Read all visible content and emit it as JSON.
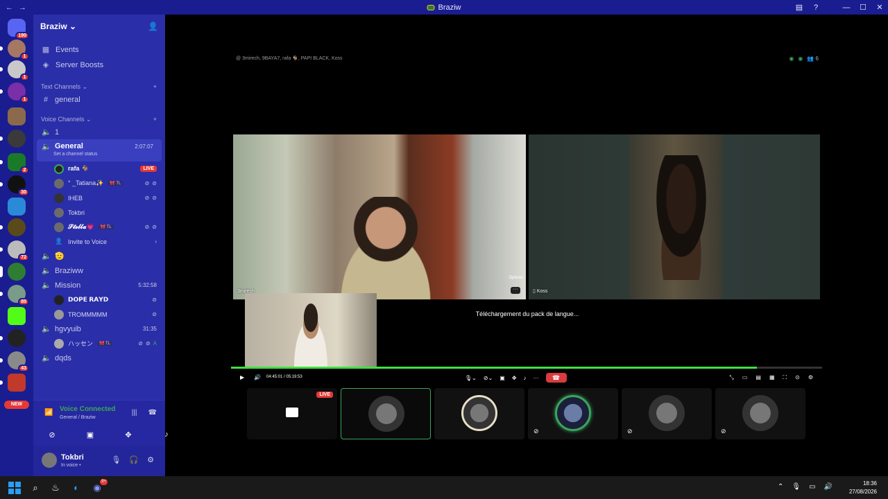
{
  "window": {
    "title": "Braziw"
  },
  "rail": {
    "home_badge": "190",
    "badges": [
      "1",
      "1",
      "1",
      "2",
      "30",
      "72",
      "85",
      "43"
    ],
    "new_label": "NEW"
  },
  "sidebar": {
    "guild_name": "Braziw",
    "links": [
      {
        "label": "Events",
        "icon": "calendar-icon"
      },
      {
        "label": "Server Boosts",
        "icon": "boost-icon"
      }
    ],
    "text_category": "Text Channels",
    "text_channels": [
      "general"
    ],
    "voice_category": "Voice Channels",
    "voice_channel_1": "1",
    "general": {
      "name": "General",
      "time": "2:07:07",
      "status": "Set a channel status"
    },
    "members": [
      {
        "name": "rafa 🐐",
        "badge": "LIVE"
      },
      {
        "name": "° _Tatiana✨",
        "tag": "🎀 TL"
      },
      {
        "name": "IHEB"
      },
      {
        "name": "Tokbri"
      },
      {
        "name": "𝓢𝓽𝓮𝓵𝓵𝓪💗",
        "tag": "🎀 TL"
      }
    ],
    "invite_label": "Invite to Voice",
    "channel_emoji": "🫡",
    "braziww": "Braziww",
    "mission": {
      "name": "Mission",
      "time": "5:32:58"
    },
    "mission_members": [
      "𝗗𝗢𝗣𝗘 𝗥𝗔𝗬𝗗",
      "TROMMMMM"
    ],
    "hgvyuib": {
      "name": "hgvyuib",
      "time": "31:35"
    },
    "hgvyuib_members": [
      {
        "name": "ハッセン",
        "tag": "🎀 TL"
      }
    ],
    "dqds": "dqds"
  },
  "voice_panel": {
    "title": "Voice Connected",
    "subtitle": "General / Braziw"
  },
  "user_panel": {
    "username": "Tokbri",
    "status": "In voice •"
  },
  "stage": {
    "participants_line": "3mirech, 9BAYA7, rafa 🐐, PAPI BLACK, Koss",
    "member_count": "6",
    "tile1_label": "3mirech",
    "tile1_options": "Options",
    "tile2_label": "Koss",
    "downloading_text": "Téléchargement du pack de langue...",
    "time_display": "04:45:01 / 05:19:53",
    "progress_fraction": 0.89,
    "strip_live": "LIVE"
  },
  "taskbar": {
    "time": "18:36",
    "date": "27/08/2026",
    "discord_badge": "9+"
  },
  "colors": {
    "titlebar": "#1a1d8f",
    "sidebar": "#2a2ea8",
    "voice_green": "#3ba55d",
    "live_red": "#e53935"
  }
}
